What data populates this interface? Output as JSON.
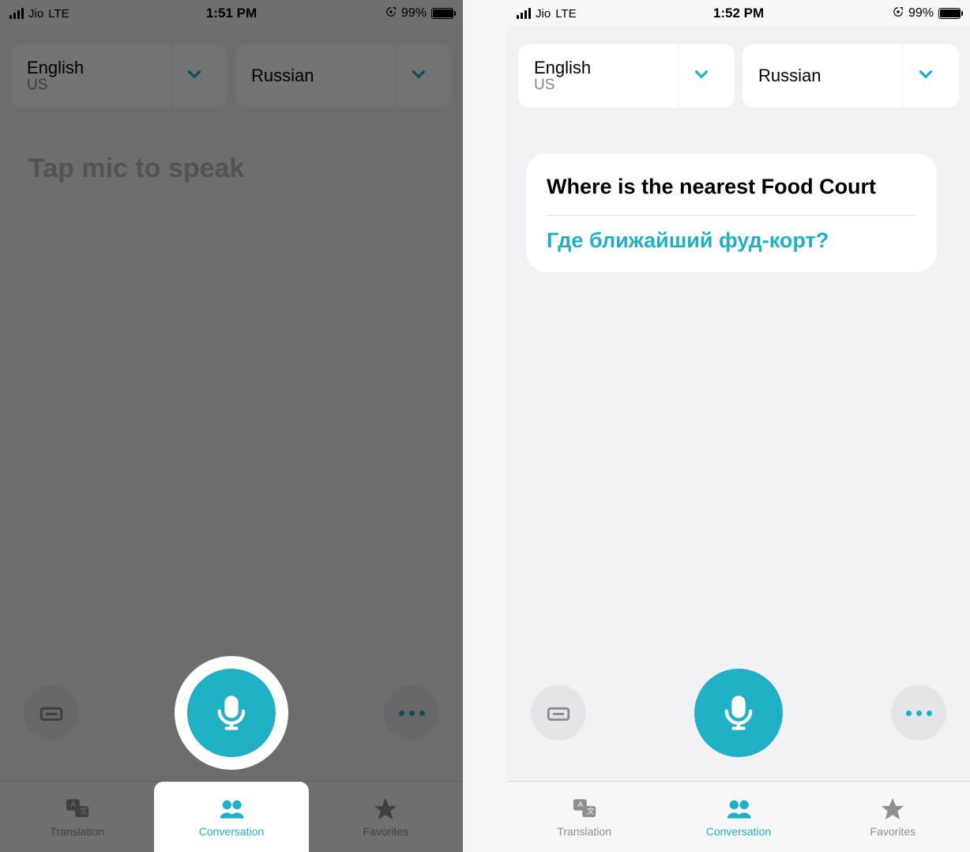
{
  "screens": [
    {
      "statusbar": {
        "carrier": "Jio",
        "network": "LTE",
        "time": "1:51 PM",
        "battery_pct": "99%"
      },
      "langs": {
        "left": {
          "name": "English",
          "sub": "US"
        },
        "right": {
          "name": "Russian",
          "sub": ""
        }
      },
      "hint": "Tap mic to speak",
      "tabs": {
        "translation": "Translation",
        "conversation": "Conversation",
        "favorites": "Favorites",
        "active": "conversation"
      }
    },
    {
      "statusbar": {
        "carrier": "Jio",
        "network": "LTE",
        "time": "1:52 PM",
        "battery_pct": "99%"
      },
      "langs": {
        "left": {
          "name": "English",
          "sub": "US"
        },
        "right": {
          "name": "Russian",
          "sub": ""
        }
      },
      "bubble": {
        "src": "Where is the nearest Food Court",
        "dst": "Где ближайший фуд-корт?"
      },
      "tabs": {
        "translation": "Translation",
        "conversation": "Conversation",
        "favorites": "Favorites",
        "active": "conversation"
      }
    }
  ],
  "colors": {
    "accent": "#1fb0c6"
  }
}
